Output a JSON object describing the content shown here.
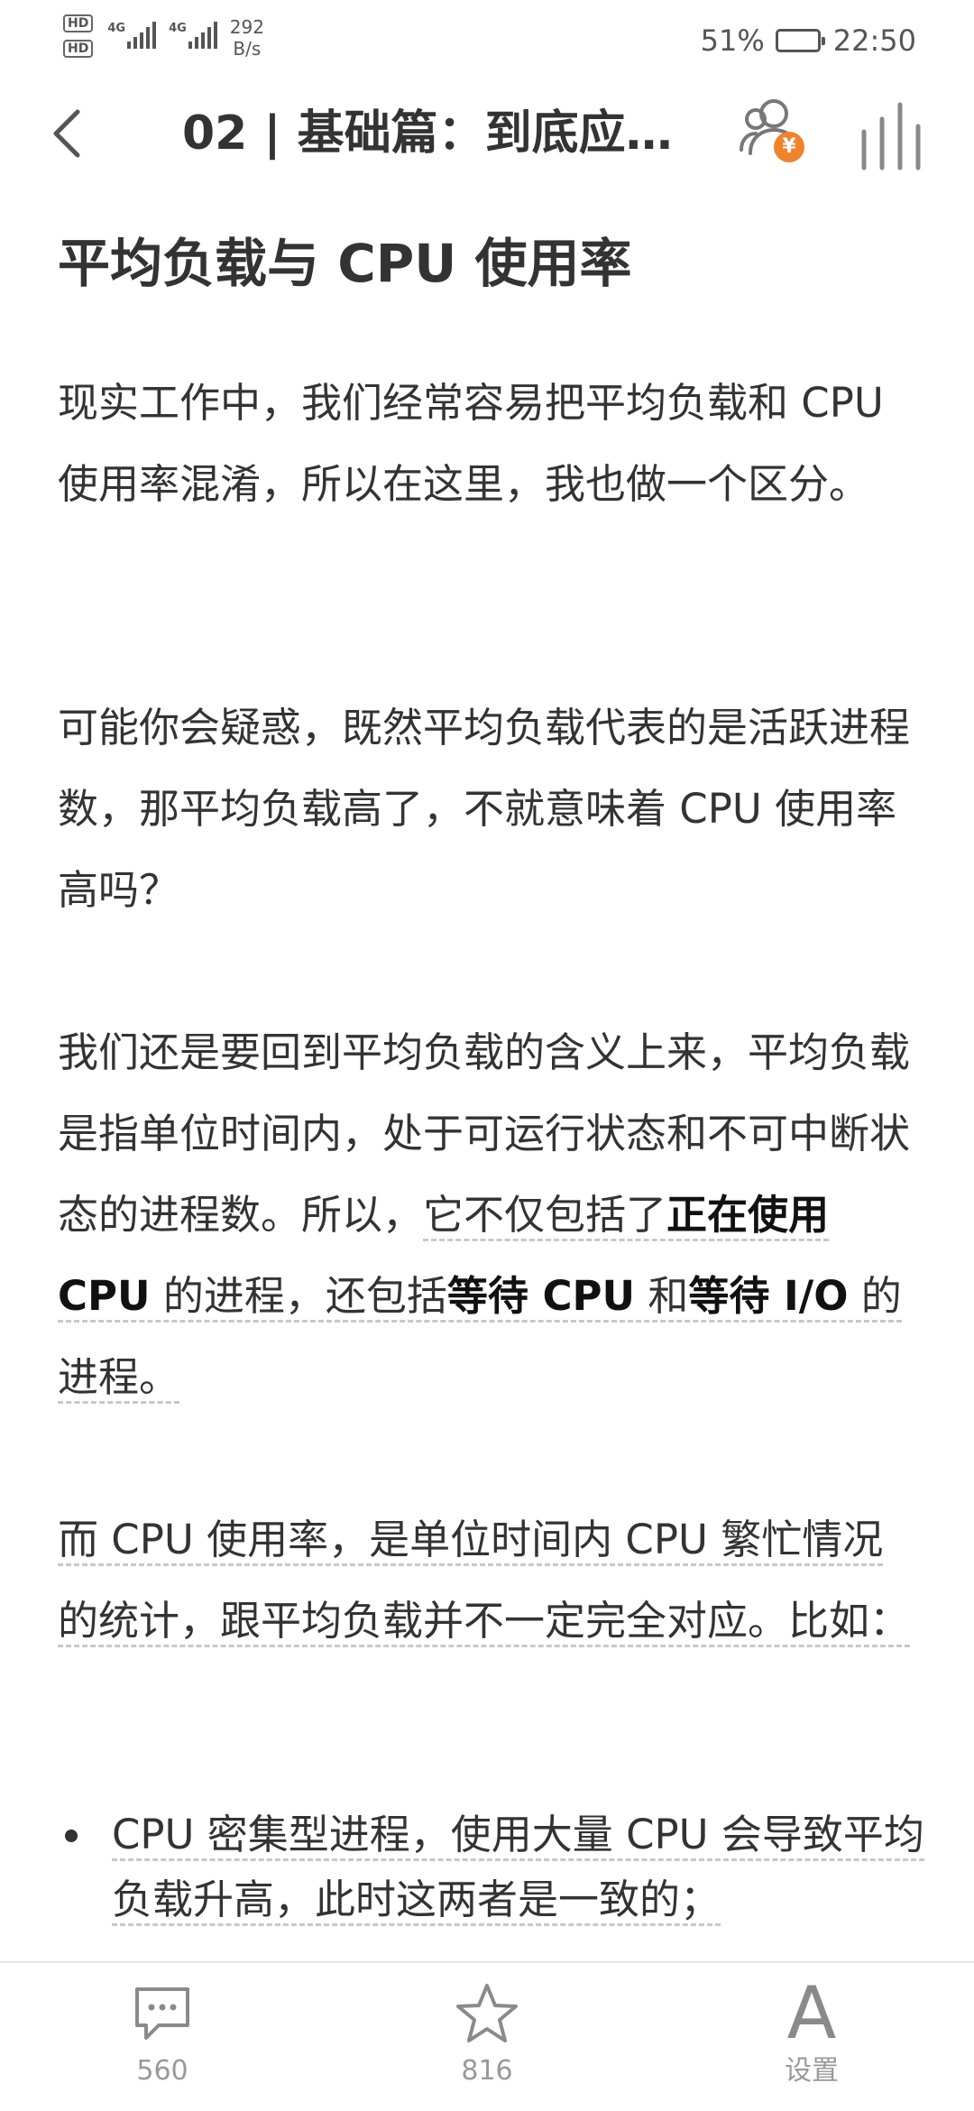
{
  "status_bar": {
    "hd1": "HD",
    "hd2": "HD",
    "network1": "4G",
    "network2": "4G",
    "speed_value": "292",
    "speed_unit": "B/s",
    "battery": "51%",
    "battery_level": 0.51,
    "time": "22:50"
  },
  "header": {
    "title": "02 | 基础篇：到底应…",
    "coin_symbol": "¥",
    "icons": {
      "back": "chevron-left-icon",
      "sponsor": "users-coin-icon",
      "stats": "bar-chart-icon"
    }
  },
  "article": {
    "heading": "平均负载与 CPU 使用率",
    "p1": "现实工作中，我们经常容易把平均负载和 CPU 使用率混淆，所以在这里，我也做一个区分。",
    "p2": "可能你会疑惑，既然平均负载代表的是活跃进程数，那平均负载高了，不就意味着 CPU 使用率高吗？",
    "p3": {
      "t1": "我们还是要回到平均负载的含义上来，平均负载是指单位时间内，处于可运行状态和不可中断状态的进程数。所以，",
      "u1": "它不仅包括了",
      "b1": "正在使用 CPU",
      "u2": " 的进程，还包括",
      "b2": "等待 CPU",
      "u3": " 和",
      "b3": "等待 I/O",
      "u4": " 的进程。"
    },
    "p4": "而 CPU 使用率，是单位时间内 CPU 繁忙情况的统计，跟平均负载并不一定完全对应。比如：",
    "bullets": [
      "CPU 密集型进程，使用大量 CPU 会导致平均负载升高，此时这两者是一致的；"
    ]
  },
  "bottom_bar": {
    "comments_count": "560",
    "favorites_count": "816",
    "settings_glyph": "A",
    "settings_label": "设置",
    "icons": {
      "comments": "comment-icon",
      "favorites": "star-icon",
      "settings": "font-settings-icon"
    }
  }
}
